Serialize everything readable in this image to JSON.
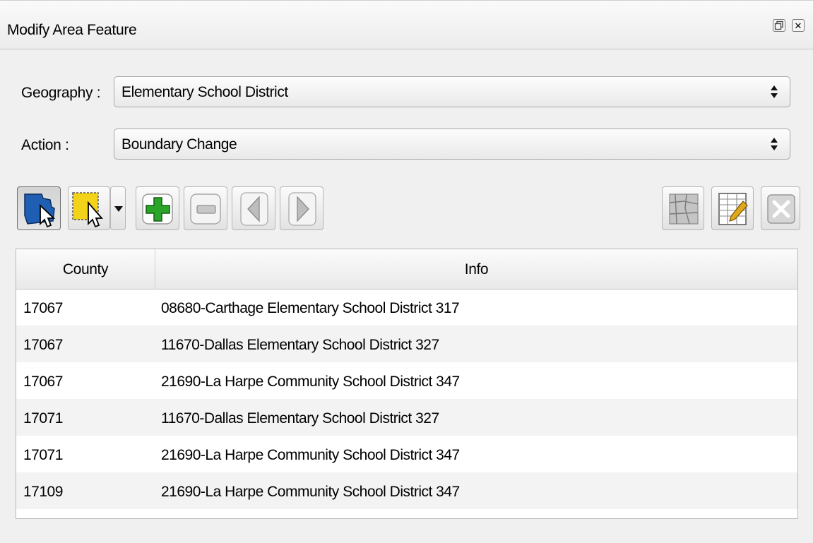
{
  "window": {
    "title": "Modify Area Feature",
    "float_icon": "float-icon",
    "close_icon": "close-icon",
    "close_glyph": "✕"
  },
  "form": {
    "geography_label": "Geography :",
    "geography_value": "Elementary School District",
    "action_label": "Action :",
    "action_value": "Boundary Change"
  },
  "toolbar": {
    "left_tools": [
      "select-feature-icon",
      "select-rectangle-icon",
      "dropdown-arrow-icon",
      "add-icon",
      "remove-icon",
      "previous-icon",
      "next-icon"
    ],
    "right_tools": [
      "map-icon",
      "edit-table-icon",
      "clear-icon"
    ]
  },
  "table": {
    "columns": [
      "County",
      "Info"
    ],
    "rows": [
      {
        "county": "17067",
        "info": "08680-Carthage Elementary School District 317"
      },
      {
        "county": "17067",
        "info": "11670-Dallas Elementary School District 327"
      },
      {
        "county": "17067",
        "info": "21690-La Harpe Community School District 347"
      },
      {
        "county": "17071",
        "info": "11670-Dallas Elementary School District 327"
      },
      {
        "county": "17071",
        "info": "21690-La Harpe Community School District 347"
      },
      {
        "county": "17109",
        "info": "21690-La Harpe Community School District 347"
      }
    ]
  },
  "colors": {
    "add_green": "#2aa52a",
    "select_blue": "#1f5fb3",
    "select_yellow": "#f3d21a"
  }
}
